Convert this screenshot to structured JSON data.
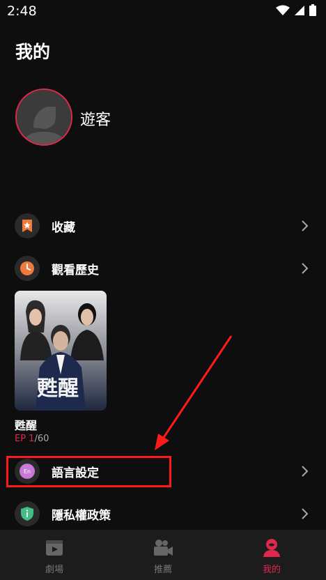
{
  "status": {
    "time": "2:48"
  },
  "page": {
    "title": "我的"
  },
  "profile": {
    "name": "遊客"
  },
  "menu": {
    "favorites": "收藏",
    "history": "觀看歷史",
    "language": "語言設定",
    "privacy": "隱私權政策"
  },
  "history_item": {
    "title": "甦醒",
    "ep_label": "EP 1",
    "ep_total": "/60",
    "poster_text": "甦醒"
  },
  "tabs": [
    {
      "label": "劇場",
      "icon": "theater-icon"
    },
    {
      "label": "推薦",
      "icon": "video-camera-icon"
    },
    {
      "label": "我的",
      "icon": "profile-icon"
    }
  ],
  "colors": {
    "accent": "#e0284f",
    "annotation": "#ff1a1a",
    "background": "#0e0e0e"
  }
}
